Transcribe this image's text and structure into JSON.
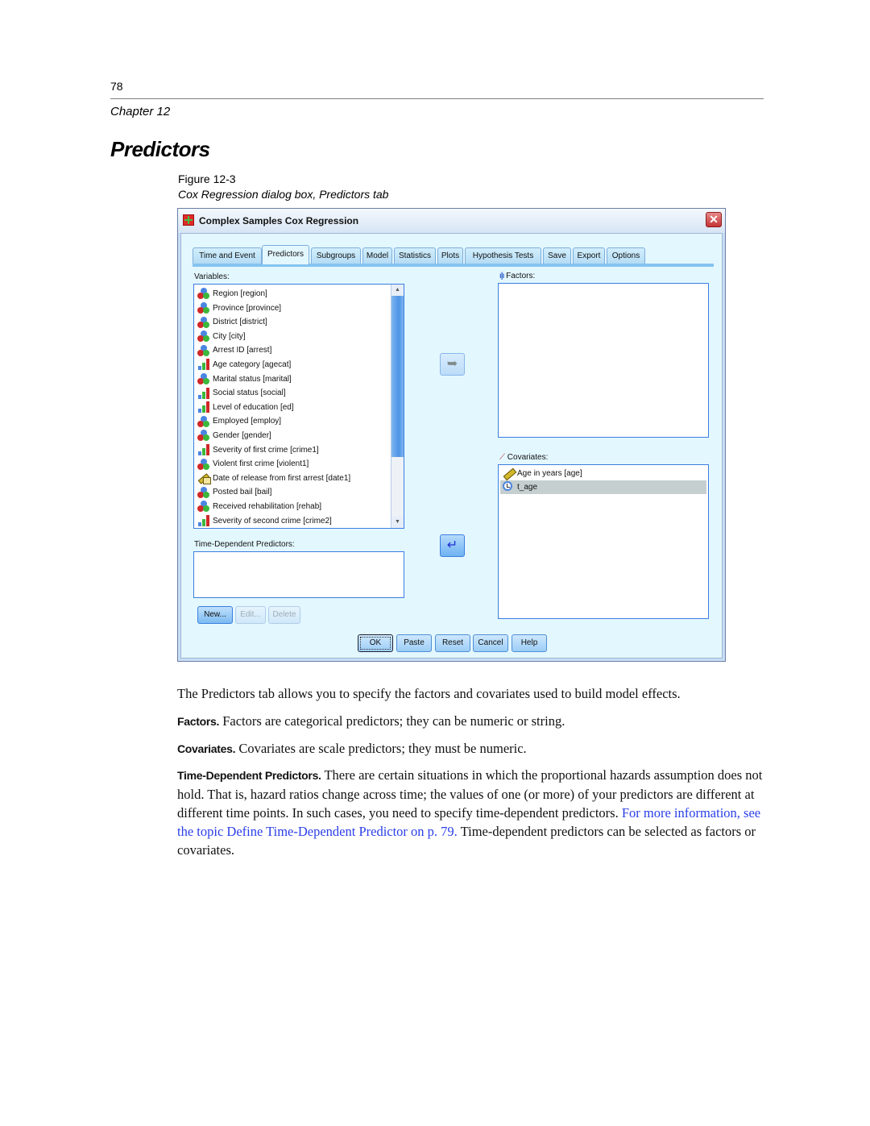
{
  "page": {
    "number": "78",
    "chapter": "Chapter 12",
    "section_title": "Predictors",
    "figure_label": "Figure 12-3",
    "figure_caption": "Cox Regression dialog box, Predictors tab"
  },
  "dialog": {
    "title": "Complex Samples Cox Regression",
    "title_icon": "spreadsheet-icon",
    "close_icon": "close-icon",
    "tabs": [
      {
        "label": "Time and Event",
        "active": false
      },
      {
        "label": "Predictors",
        "active": true
      },
      {
        "label": "Subgroups",
        "active": false
      },
      {
        "label": "Model",
        "active": false
      },
      {
        "label": "Statistics",
        "active": false
      },
      {
        "label": "Plots",
        "active": false
      },
      {
        "label": "Hypothesis Tests",
        "active": false
      },
      {
        "label": "Save",
        "active": false
      },
      {
        "label": "Export",
        "active": false
      },
      {
        "label": "Options",
        "active": false
      }
    ],
    "variables_label": "Variables:",
    "variables": [
      {
        "label": "Region [region]",
        "type": "nominal"
      },
      {
        "label": "Province [province]",
        "type": "nominal"
      },
      {
        "label": "District [district]",
        "type": "nominal"
      },
      {
        "label": "City [city]",
        "type": "nominal"
      },
      {
        "label": "Arrest ID [arrest]",
        "type": "nominal"
      },
      {
        "label": "Age category [agecat]",
        "type": "ordinal"
      },
      {
        "label": "Marital status [marital]",
        "type": "nominal"
      },
      {
        "label": "Social status [social]",
        "type": "ordinal"
      },
      {
        "label": "Level of education [ed]",
        "type": "ordinal"
      },
      {
        "label": "Employed [employ]",
        "type": "nominal"
      },
      {
        "label": "Gender [gender]",
        "type": "nominal"
      },
      {
        "label": "Severity of first crime [crime1]",
        "type": "ordinal"
      },
      {
        "label": "Violent first crime [violent1]",
        "type": "nominal"
      },
      {
        "label": "Date of release from first arrest [date1]",
        "type": "date"
      },
      {
        "label": "Posted bail [bail]",
        "type": "nominal"
      },
      {
        "label": "Received rehabilitation [rehab]",
        "type": "nominal"
      },
      {
        "label": "Severity of second crime [crime2]",
        "type": "ordinal"
      }
    ],
    "factors_label": "Factors:",
    "factors": [],
    "covariates_label": "Covariates:",
    "covariates": [
      {
        "label": "Age in years [age]",
        "type": "scale",
        "selected": false
      },
      {
        "label": "t_age",
        "type": "time",
        "selected": true
      }
    ],
    "move_to_factors_icon": "arrow-right-icon",
    "move_to_covariates_icon": "arrow-left-icon",
    "time_dependent_label": "Time-Dependent Predictors:",
    "time_dependent": [],
    "td_buttons": {
      "new": "New...",
      "edit": "Edit...",
      "delete": "Delete"
    },
    "footer_buttons": {
      "ok": "OK",
      "paste": "Paste",
      "reset": "Reset",
      "cancel": "Cancel",
      "help": "Help"
    }
  },
  "body": {
    "intro": "The Predictors tab allows you to specify the factors and covariates used to build model effects.",
    "factors_lead": "Factors.",
    "factors_text": " Factors are categorical predictors; they can be numeric or string.",
    "covariates_lead": "Covariates.",
    "covariates_text": " Covariates are scale predictors; they must be numeric.",
    "td_lead": "Time-Dependent Predictors.",
    "td_text": " There are certain situations in which the proportional hazards assumption does not hold. That is, hazard ratios change across time; the values of one (or more) of your predictors are different at different time points.  In such cases, you need to specify time-dependent predictors. ",
    "td_link": "For more information, see the topic Define Time-Dependent Predictor on p. 79.",
    "td_tail": " Time-dependent predictors can be selected as factors or covariates.",
    "link_color": "#2a3ee8"
  }
}
